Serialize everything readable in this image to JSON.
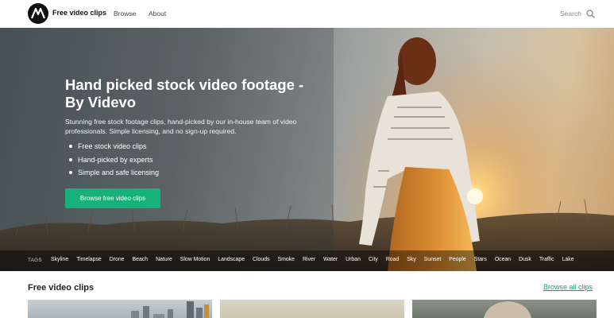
{
  "header": {
    "logo_icon": "videvo-logo-icon",
    "brand": "Free video clips",
    "nav": [
      "Browse",
      "About"
    ],
    "search_label": "Search",
    "search_icon": "search-icon"
  },
  "hero": {
    "title": "Hand picked stock video footage - By Videvo",
    "subtitle": "Stunning free stock footage clips, hand-picked by our in-house team of video professionals. Simple licensing, and no sign-up required.",
    "bullets": [
      "Free stock video clips",
      "Hand-picked by experts",
      "Simple and safe licensing"
    ],
    "cta": "Browse free video clips",
    "cta_color": "#17b27b"
  },
  "tags": {
    "label": "TAGS",
    "items": [
      "Skyline",
      "Timelapse",
      "Drone",
      "Beach",
      "Nature",
      "Slow Motion",
      "Landscape",
      "Clouds",
      "Smoke",
      "River",
      "Water",
      "Urban",
      "City",
      "Road",
      "Sky",
      "Sunset",
      "People",
      "Stars",
      "Ocean",
      "Dusk",
      "Traffic",
      "Lake"
    ]
  },
  "section": {
    "title": "Free video clips",
    "browse_all": "Browse all clips",
    "accent": "#17a36e"
  }
}
